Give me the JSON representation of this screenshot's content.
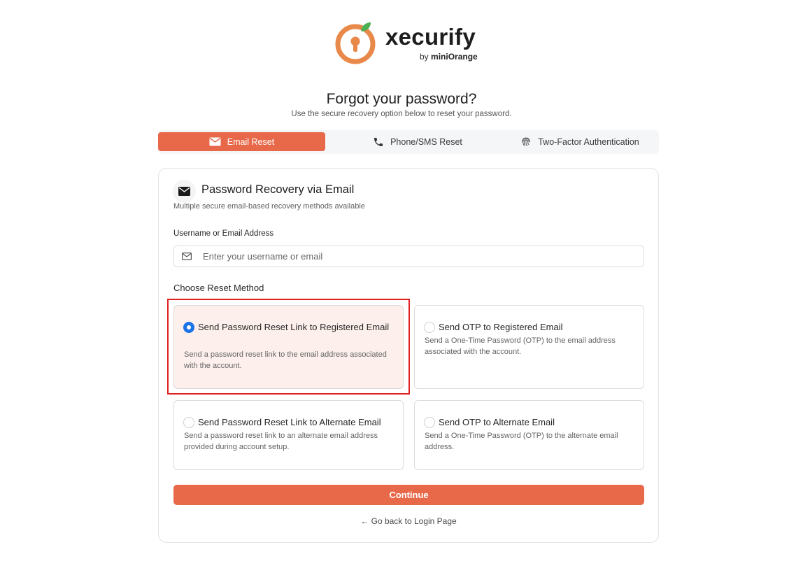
{
  "brand": {
    "name": "xecurify",
    "by_prefix": "by",
    "by_company": "miniOrange",
    "accent_color": "#e8694a",
    "leaf_color": "#4caf50"
  },
  "header": {
    "title": "Forgot your password?",
    "subtitle": "Use the secure recovery option below to reset your password."
  },
  "tabs": [
    {
      "label": "Email Reset",
      "icon": "mail-icon",
      "active": true
    },
    {
      "label": "Phone/SMS Reset",
      "icon": "phone-icon",
      "active": false
    },
    {
      "label": "Two-Factor Authentication",
      "icon": "fingerprint-icon",
      "active": false
    }
  ],
  "card": {
    "icon": "mail-icon",
    "title": "Password Recovery via Email",
    "subtitle": "Multiple secure email-based recovery methods available",
    "field": {
      "label": "Username or Email Address",
      "placeholder": "Enter your username or email",
      "value": ""
    },
    "method_label": "Choose Reset Method",
    "options": [
      {
        "title": "Send Password Reset Link to Registered Email",
        "description": "Send a password reset link to the email address associated with the account.",
        "selected": true
      },
      {
        "title": "Send OTP to Registered Email",
        "description": "Send a One-Time Password (OTP) to the email address associated with the account.",
        "selected": false
      },
      {
        "title": "Send Password Reset Link to Alternate Email",
        "description": "Send a password reset link to an alternate email address provided during account setup.",
        "selected": false
      },
      {
        "title": "Send OTP to Alternate Email",
        "description": "Send a One-Time Password (OTP) to the alternate email address.",
        "selected": false
      }
    ],
    "continue_label": "Continue",
    "back_label": "← Go back to Login Page"
  }
}
